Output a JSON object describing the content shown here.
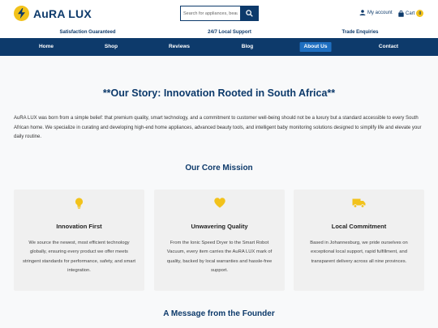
{
  "brand": {
    "name": "AuRA LUX"
  },
  "search": {
    "placeholder": "Search for appliances, beauty"
  },
  "header": {
    "account_label": "My account",
    "cart_label": "Cart",
    "cart_count": "0"
  },
  "trust_bar": [
    "Satisfaction Guaranteed",
    "24/7 Local Support",
    "Trade Enquiries"
  ],
  "nav": {
    "items": [
      {
        "label": "Home"
      },
      {
        "label": "Shop"
      },
      {
        "label": "Reviews"
      },
      {
        "label": "Blog"
      },
      {
        "label": "About Us",
        "active": true
      },
      {
        "label": "Contact"
      }
    ]
  },
  "story": {
    "title": "**Our Story: Innovation Rooted in South Africa**",
    "text": "AuRA LUX was born from a simple belief: that premium quality, smart technology, and a commitment to customer well-being should not be a luxury but a standard accessible to every South African home. We specialize in curating and developing high-end home appliances, advanced beauty tools, and intelligent baby monitoring solutions designed to simplify life and elevate your daily routine."
  },
  "mission": {
    "title": "Our Core Mission",
    "cards": [
      {
        "icon": "lightbulb-icon",
        "title": "Innovation First",
        "text": "We source the newest, most efficient technology globally, ensuring every product we offer meets stringent standards for performance, safety, and smart integration."
      },
      {
        "icon": "heart-icon",
        "title": "Unwavering Quality",
        "text": "From the Ionic Speed Dryer to the Smart Robot Vacuum, every item carries the AuRA LUX mark of quality, backed by local warranties and hassle-free support."
      },
      {
        "icon": "truck-icon",
        "title": "Local Commitment",
        "text": "Based in Johannesburg, we pride ourselves on exceptional local support, rapid fulfillment, and transparent delivery across all nine provinces."
      }
    ]
  },
  "founder": {
    "title": "A Message from the Founder"
  },
  "colors": {
    "primary": "#0d3a6b",
    "accent": "#f2c21b",
    "active_nav": "#1e6fc1"
  }
}
